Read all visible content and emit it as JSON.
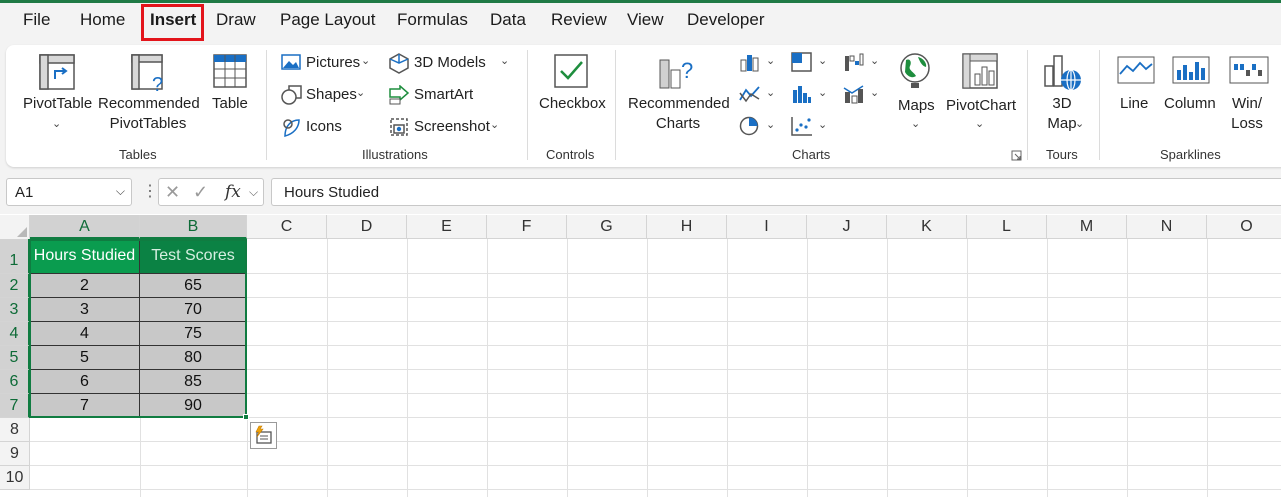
{
  "tabs": [
    "File",
    "Home",
    "Insert",
    "Draw",
    "Page Layout",
    "Formulas",
    "Data",
    "Review",
    "View",
    "Developer"
  ],
  "active_tab": "Insert",
  "ribbon": {
    "tables": {
      "label": "Tables",
      "pivottable": "PivotTable",
      "recommended_line1": "Recommended",
      "recommended_line2": "PivotTables",
      "table": "Table"
    },
    "illustrations": {
      "label": "Illustrations",
      "pictures": "Pictures",
      "shapes": "Shapes",
      "icons": "Icons",
      "models3d": "3D Models",
      "smartart": "SmartArt",
      "screenshot": "Screenshot"
    },
    "controls": {
      "label": "Controls",
      "checkbox": "Checkbox"
    },
    "charts": {
      "label": "Charts",
      "recommended_line1": "Recommended",
      "recommended_line2": "Charts",
      "maps": "Maps",
      "pivotchart": "PivotChart"
    },
    "tours": {
      "label": "Tours",
      "map3d_line1": "3D",
      "map3d_line2": "Map"
    },
    "sparklines": {
      "label": "Sparklines",
      "line": "Line",
      "column": "Column",
      "winloss_line1": "Win/",
      "winloss_line2": "Loss"
    }
  },
  "formula_bar": {
    "name_box": "A1",
    "fx": "fx",
    "value": "Hours Studied"
  },
  "sheet": {
    "columns": [
      "A",
      "B",
      "C",
      "D",
      "E",
      "F",
      "G",
      "H",
      "I",
      "J",
      "K",
      "L",
      "M",
      "N",
      "O"
    ],
    "rows": [
      "1",
      "2",
      "3",
      "4",
      "5",
      "6",
      "7",
      "8",
      "9",
      "10"
    ],
    "headers": [
      "Hours Studied",
      "Test Scores"
    ],
    "data": [
      [
        "2",
        "65"
      ],
      [
        "3",
        "70"
      ],
      [
        "4",
        "75"
      ],
      [
        "5",
        "80"
      ],
      [
        "6",
        "85"
      ],
      [
        "7",
        "90"
      ]
    ]
  },
  "colors": {
    "accent": "#107c41",
    "header_fill": "#0a9c4f",
    "highlight": "#e3141b"
  }
}
